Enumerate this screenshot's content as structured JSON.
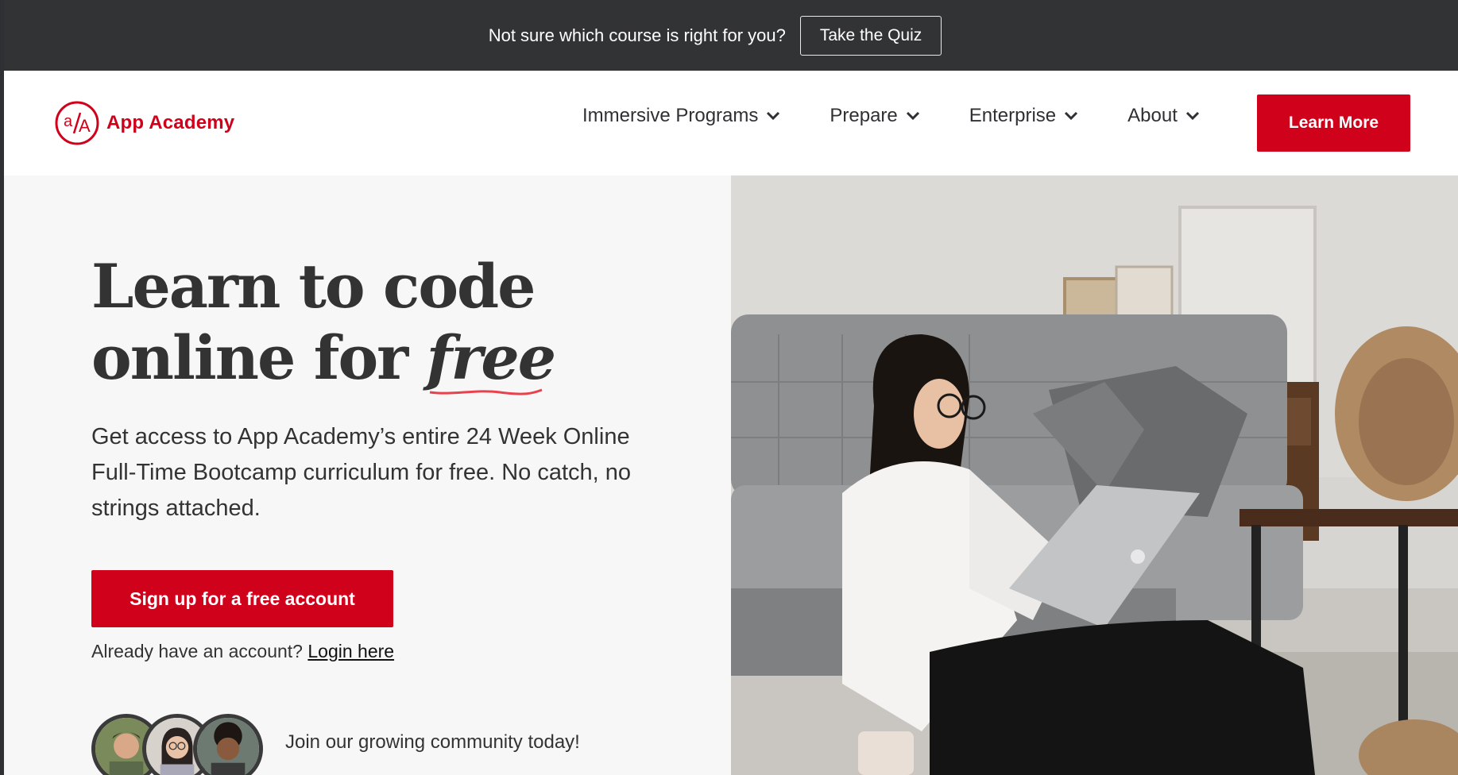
{
  "topbar": {
    "text": "Not sure which course is right for you?",
    "quiz_button": "Take the Quiz"
  },
  "brand": {
    "name": "App Academy",
    "logo_glyph": "a/A",
    "accent_color": "#d0021b"
  },
  "nav": {
    "items": [
      {
        "label": "Immersive Programs",
        "icon": "chevron-down-icon"
      },
      {
        "label": "Prepare",
        "icon": "chevron-down-icon"
      },
      {
        "label": "Enterprise",
        "icon": "chevron-down-icon"
      },
      {
        "label": "About",
        "icon": "chevron-down-icon"
      }
    ],
    "cta": "Learn More"
  },
  "hero": {
    "headline_line1": "Learn to code",
    "headline_line2": "online for ",
    "headline_emphasis": "free",
    "subcopy": "Get access to App Academy’s entire 24 Week Online Full-Time Bootcamp curriculum for free. No catch, no strings attached.",
    "signup_button": "Sign up for a free account",
    "login_prompt": "Already have an account? ",
    "login_link": "Login here",
    "community_text": "Join our growing community today!"
  }
}
